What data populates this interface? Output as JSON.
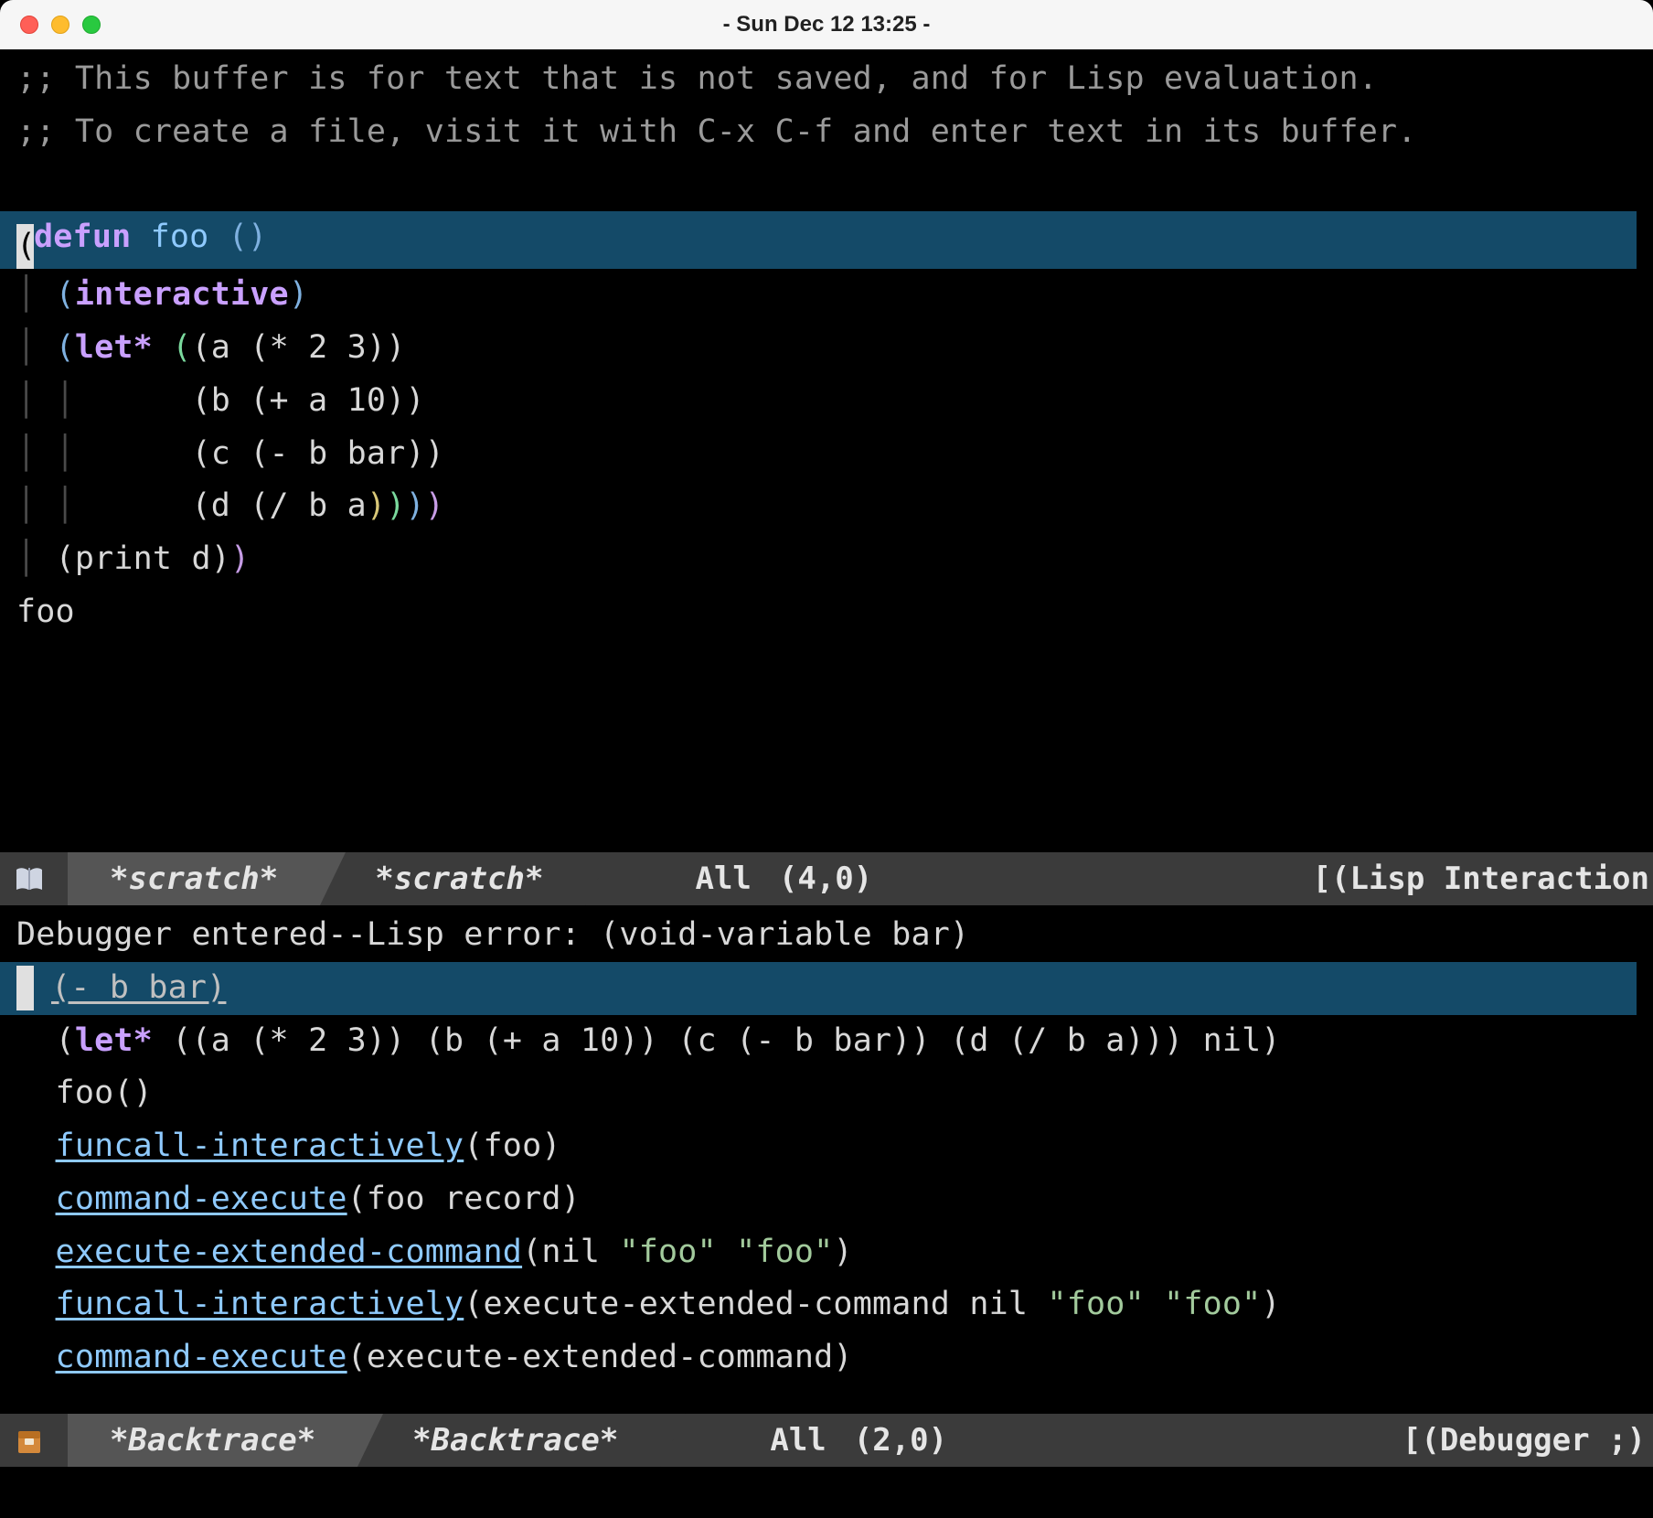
{
  "window": {
    "title": "- Sun Dec 12  13:25 -"
  },
  "colors": {
    "highlight": "#144a68",
    "cursor": "#e0e0e0",
    "background": "#000000"
  },
  "scratch": {
    "comment1": ";; This buffer is for text that is not saved, and for Lisp evaluation.",
    "comment2": ";; To create a file, visit it with C-x C-f and enter text in its buffer.",
    "defun_kw": "defun",
    "fn_name": "foo",
    "args": "()",
    "interactive_kw": "interactive",
    "let_kw": "let*",
    "bind_a": "(a (* 2 3))",
    "bind_b": "(b (+ a 10))",
    "bind_c": "(c (- b bar))",
    "bind_d_open": "(d (/ b a",
    "print_expr": "(print d)",
    "eval_echo": "foo"
  },
  "modeline_top": {
    "buf_active": "*scratch*",
    "buf_inactive": "*scratch*",
    "scroll": "All",
    "pos": "(4,0)",
    "mode": "[(Lisp Interaction"
  },
  "backtrace": {
    "error_line": "Debugger entered--Lisp error: (void-variable bar)",
    "frame_hl": "(- b bar)",
    "let_kw": "let*",
    "let_rest": " ((a (* 2 3)) (b (+ a 10)) (c (- b bar)) (d (/ b a))) nil)",
    "fn_call": "foo()",
    "fi1_fn": "funcall-interactively",
    "fi1_args": "(foo)",
    "ce1_fn": "command-execute",
    "ce1_args": "(foo record)",
    "eec_fn": "execute-extended-command",
    "eec_args_pre": "(nil ",
    "eec_s1": "\"foo\"",
    "eec_sep": " ",
    "eec_s2": "\"foo\"",
    "eec_args_post": ")",
    "fi2_fn": "funcall-interactively",
    "fi2_args_pre": "(execute-extended-command nil ",
    "fi2_s1": "\"foo\"",
    "fi2_sep": " ",
    "fi2_s2": "\"foo\"",
    "fi2_args_post": ")",
    "ce2_fn": "command-execute",
    "ce2_args": "(execute-extended-command)"
  },
  "modeline_bot": {
    "buf_active": "*Backtrace*",
    "buf_inactive": "*Backtrace*",
    "scroll": "All",
    "pos": "(2,0)",
    "mode": "[(Debugger ;)"
  }
}
